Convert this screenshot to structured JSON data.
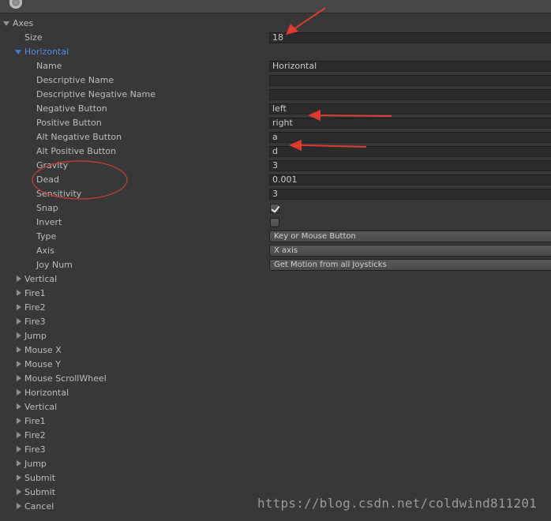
{
  "axes": {
    "header_label": "Axes",
    "size_label": "Size",
    "size_value": "18",
    "expanded_axis": {
      "label": "Horizontal",
      "props": {
        "name": {
          "label": "Name",
          "value": "Horizontal"
        },
        "descriptive_name": {
          "label": "Descriptive Name",
          "value": ""
        },
        "descriptive_negative_name": {
          "label": "Descriptive Negative Name",
          "value": ""
        },
        "negative_button": {
          "label": "Negative Button",
          "value": "left"
        },
        "positive_button": {
          "label": "Positive Button",
          "value": "right"
        },
        "alt_negative_button": {
          "label": "Alt Negative Button",
          "value": "a"
        },
        "alt_positive_button": {
          "label": "Alt Positive Button",
          "value": "d"
        },
        "gravity": {
          "label": "Gravity",
          "value": "3"
        },
        "dead": {
          "label": "Dead",
          "value": "0.001"
        },
        "sensitivity": {
          "label": "Sensitivity",
          "value": "3"
        },
        "snap": {
          "label": "Snap",
          "checked": true
        },
        "invert": {
          "label": "Invert",
          "checked": false
        },
        "type": {
          "label": "Type",
          "value": "Key or Mouse Button"
        },
        "axis": {
          "label": "Axis",
          "value": "X axis"
        },
        "joy_num": {
          "label": "Joy Num",
          "value": "Get Motion from all Joysticks"
        }
      }
    },
    "collapsed_axes": [
      "Vertical",
      "Fire1",
      "Fire2",
      "Fire3",
      "Jump",
      "Mouse X",
      "Mouse Y",
      "Mouse ScrollWheel",
      "Horizontal",
      "Vertical",
      "Fire1",
      "Fire2",
      "Fire3",
      "Jump",
      "Submit",
      "Submit",
      "Cancel"
    ]
  },
  "watermark": "https://blog.csdn.net/coldwind811201",
  "colors": {
    "background": "#383838",
    "field_bg": "#2b2b2b",
    "selected_blue": "#4f8fe8",
    "annotation_red": "#e03a2e"
  },
  "icons": {
    "inspector_icon": "gear-icon",
    "expand_arrow": "triangle-down-icon",
    "collapse_arrow": "triangle-right-icon",
    "checkbox_mark": "check-icon"
  }
}
